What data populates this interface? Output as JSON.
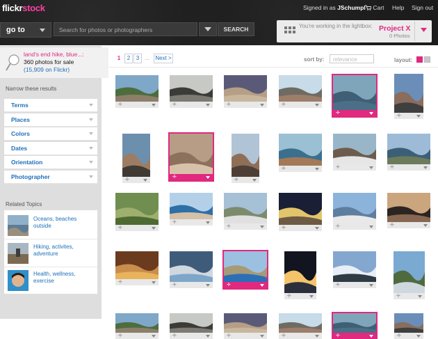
{
  "header": {
    "logo_part1": "flickr",
    "logo_part2": "stock",
    "signed_in": "Signed in as ",
    "username": "JSchumpl",
    "cart": "Cart",
    "help": "Help",
    "signout": "Sign out",
    "goto_label": "go to",
    "search_placeholder": "Search for photos or photographers",
    "search_button": "SEARCH",
    "lightbox_text": "You're working in the lightbox:",
    "project_name": "Project X",
    "project_count": "0 Photos"
  },
  "sidebar": {
    "result_title": "land's end hike, blue...:",
    "result_count": "360 photos for sale",
    "result_flickr": "(15,909 on Flickr)",
    "narrow_title": "Narrow these results",
    "facets": [
      "Terms",
      "Places",
      "Colors",
      "Dates",
      "Orientation",
      "Photographer"
    ],
    "related_title": "Related Topics",
    "topics": [
      {
        "label": "Oceans, beaches outside"
      },
      {
        "label": "Hiking, activites, adventure"
      },
      {
        "label": "Health, wellness, exercise"
      }
    ]
  },
  "main": {
    "pages": [
      "1",
      "2",
      "3"
    ],
    "dots": "...",
    "next": "Next >",
    "sort_label": "sort by:",
    "sort_value": "relevance",
    "layout_label": "layout:"
  },
  "colors": {
    "accent": "#e0297f",
    "link": "#1e6fb8",
    "header_bg": "#1c1c1c"
  }
}
